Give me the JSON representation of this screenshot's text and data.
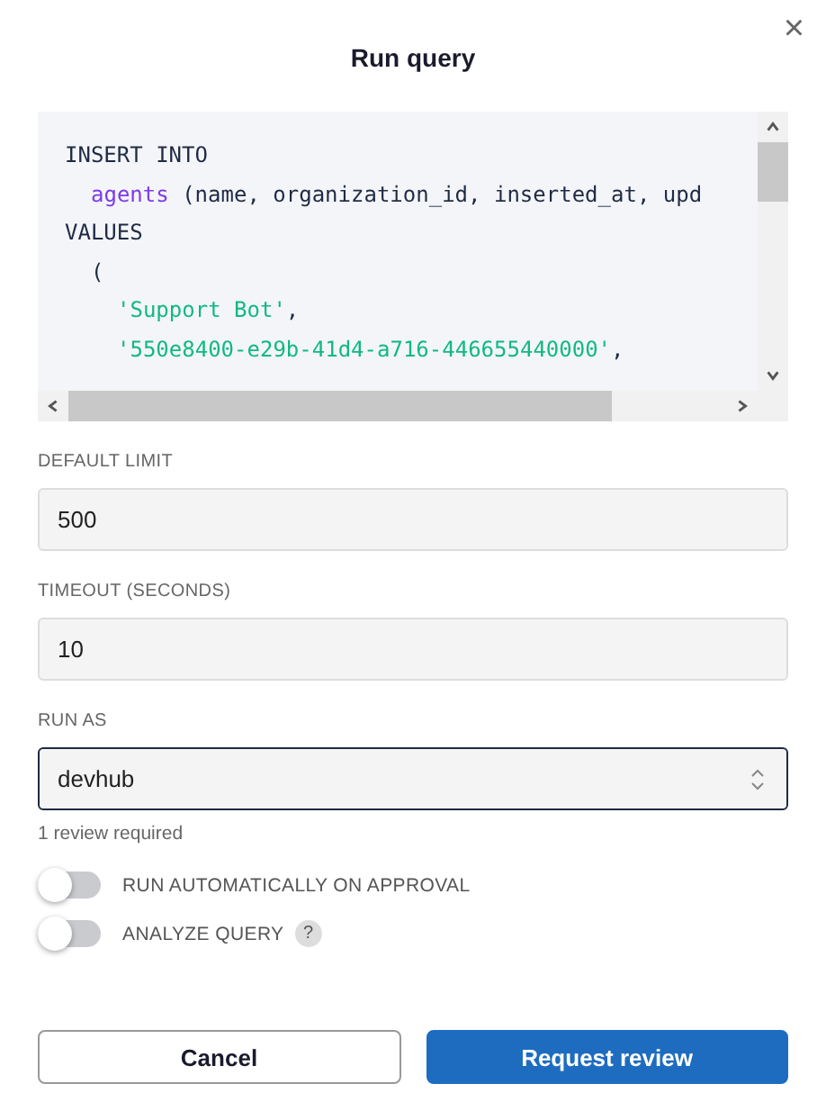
{
  "dialog": {
    "title": "Run query",
    "close": "×"
  },
  "code": {
    "lines": [
      {
        "kind": "clause",
        "parts": [
          {
            "kind": "plain",
            "text": "INSERT INTO"
          }
        ]
      },
      {
        "kind": "nested",
        "parts": [
          {
            "kind": "keyword",
            "text": "agents"
          },
          {
            "kind": "plain",
            "text": " (name, organization_id, inserted_at, upd"
          }
        ]
      },
      {
        "kind": "clause",
        "parts": [
          {
            "kind": "plain",
            "text": "VALUES"
          }
        ]
      },
      {
        "kind": "nested",
        "parts": [
          {
            "kind": "plain",
            "text": "("
          }
        ]
      },
      {
        "kind": "value",
        "parts": [
          {
            "kind": "string",
            "text": "'Support Bot'"
          },
          {
            "kind": "plain",
            "text": ","
          }
        ]
      },
      {
        "kind": "value",
        "parts": [
          {
            "kind": "string",
            "text": "'550e8400-e29b-41d4-a716-446655440000'"
          },
          {
            "kind": "plain",
            "text": ","
          }
        ]
      }
    ]
  },
  "fields": [
    {
      "kind": "input",
      "label": "DEFAULT LIMIT",
      "value": "500"
    },
    {
      "kind": "input",
      "label": "TIMEOUT (SECONDS)",
      "value": "10"
    },
    {
      "kind": "select",
      "label": "RUN AS",
      "value": "devhub",
      "hint": "1 review required"
    }
  ],
  "toggles": [
    {
      "label": "RUN AUTOMATICALLY ON APPROVAL",
      "on": false
    },
    {
      "label": "ANALYZE QUERY",
      "on": false,
      "help": "?"
    }
  ],
  "buttons": [
    {
      "kind": "secondary",
      "label": "Cancel"
    },
    {
      "kind": "primary",
      "label": "Request review"
    }
  ]
}
